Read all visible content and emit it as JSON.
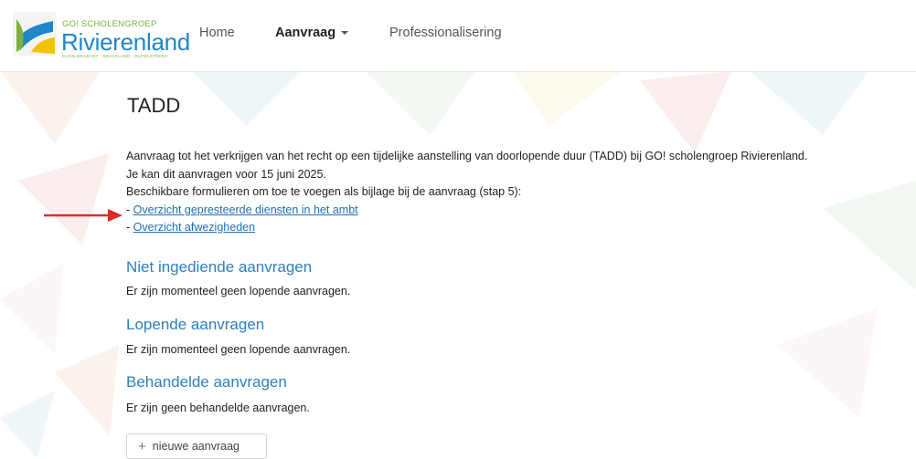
{
  "brand": {
    "small": "GO! SCHOLENGROEP",
    "name": "Rivierenland",
    "tagline": "KLEIN-BRABANT · BRAAKLAND · RUPELSTREEK"
  },
  "nav": {
    "home": "Home",
    "aanvraag": "Aanvraag",
    "professionalisering": "Professionalisering"
  },
  "page": {
    "title": "TADD",
    "intro_line1": "Aanvraag tot het verkrijgen van het recht op een tijdelijke aanstelling van doorlopende duur (TADD) bij GO! scholengroep Rivierenland.",
    "intro_line2": "Je kan dit aanvragen voor 15 juni 2025.",
    "intro_line3": "Beschikbare formulieren om toe te voegen als bijlage bij de aanvraag (stap 5):",
    "link_prefix": "- ",
    "link1": "Overzicht gepresteerde diensten in het ambt",
    "link2": "Overzicht afwezigheden"
  },
  "sections": {
    "niet_ingediend_title": "Niet ingediende aanvragen",
    "niet_ingediend_text": "Er zijn momenteel geen lopende aanvragen.",
    "lopend_title": "Lopende aanvragen",
    "lopend_text": "Er zijn momenteel geen lopende aanvragen.",
    "behandeld_title": "Behandelde aanvragen",
    "behandeld_text": "Er zijn geen behandelde aanvragen."
  },
  "actions": {
    "new_request": "nieuwe aanvraag"
  },
  "colors": {
    "brand_blue": "#1f86c8",
    "brand_green": "#7bb23b",
    "heading_blue": "#2e7fbd",
    "link_blue": "#1f6fb3",
    "arrow_red": "#e02a2a"
  }
}
